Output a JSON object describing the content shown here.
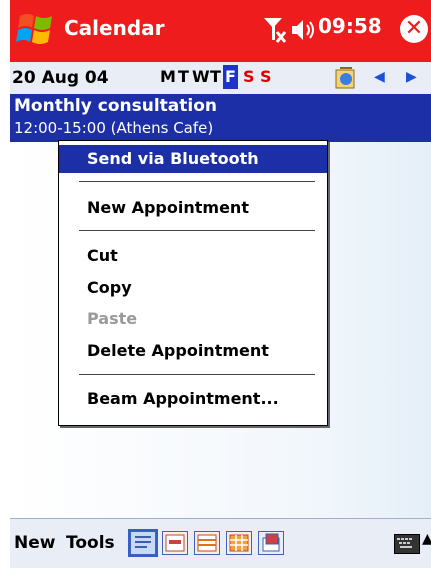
{
  "titlebar": {
    "app_title": "Calendar",
    "time": "09:58",
    "icons": [
      "windows-start-icon",
      "signal-icon",
      "speaker-icon",
      "close-icon"
    ],
    "color": "#ee1c1c"
  },
  "datebar": {
    "date": "20 Aug 04",
    "days": [
      "M",
      "T",
      "W",
      "T",
      "F",
      "S",
      "S"
    ],
    "selected_day_index": 4,
    "weekend_color": "#e00000",
    "selected_color": "#1c35c8"
  },
  "appointment": {
    "title": "Monthly consultation",
    "detail": "12:00-15:00 (Athens Cafe)",
    "color": "#1c2fa6"
  },
  "menu": {
    "items": [
      {
        "label": "Send via Bluetooth",
        "state": "highlighted"
      },
      {
        "label": "New Appointment",
        "state": "normal"
      },
      {
        "label": "Cut",
        "state": "normal"
      },
      {
        "label": "Copy",
        "state": "normal"
      },
      {
        "label": "Paste",
        "state": "disabled"
      },
      {
        "label": "Delete Appointment",
        "state": "normal"
      },
      {
        "label": "Beam Appointment...",
        "state": "normal"
      }
    ]
  },
  "bottombar": {
    "new_label": "New",
    "tools_label": "Tools",
    "view_icons": [
      "agenda-view-icon",
      "day-view-icon",
      "week-view-icon",
      "month-view-icon",
      "year-view-icon"
    ],
    "active_view_index": 0
  }
}
